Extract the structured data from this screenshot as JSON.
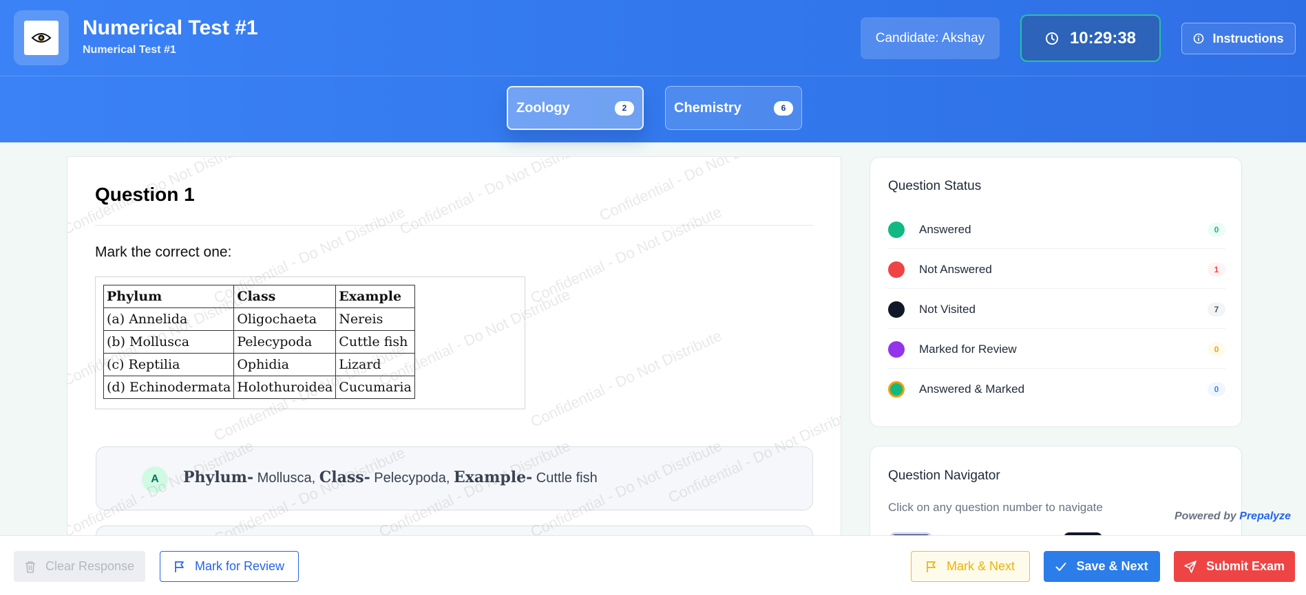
{
  "header": {
    "title": "Numerical Test #1",
    "subtitle": "Numerical Test #1",
    "candidate": "Candidate: Akshay",
    "timer": "10:29:38",
    "instructions": "Instructions"
  },
  "tabs": [
    {
      "label": "Zoology",
      "count": "2"
    },
    {
      "label": "Chemistry",
      "count": "6"
    }
  ],
  "question": {
    "title": "Question 1",
    "text": "Mark the correct one:",
    "table": {
      "headers": [
        "Phylum",
        "Class",
        "Example"
      ],
      "rows": [
        [
          "(a) Annelida",
          "Oligochaeta",
          "Nereis"
        ],
        [
          "(b) Mollusca",
          "Pelecypoda",
          "Cuttle fish"
        ],
        [
          "(c) Reptilia",
          "Ophidia",
          "Lizard"
        ],
        [
          "(d) Echinodermata",
          "Holothuroidea",
          "Cucumaria"
        ]
      ]
    },
    "options": [
      {
        "letter": "A",
        "phylum_label": "Phylum-",
        "phylum_value": "Mollusca,",
        "class_label": "Class-",
        "class_value": "Pelecypoda,",
        "example_label": "Example-",
        "example_value": "Cuttle fish"
      }
    ]
  },
  "watermark": "Confidential - Do Not Distribute",
  "status": {
    "title": "Question Status",
    "items": [
      {
        "label": "Answered",
        "count": "0",
        "color": "#10b981"
      },
      {
        "label": "Not Answered",
        "count": "1",
        "color": "#ef4444"
      },
      {
        "label": "Not Visited",
        "count": "7",
        "color": "#111827"
      },
      {
        "label": "Marked for Review",
        "count": "0",
        "color": "#9333ea"
      },
      {
        "label": "Answered & Marked",
        "count": "0",
        "color": "#10b981"
      }
    ]
  },
  "navigator": {
    "title": "Question Navigator",
    "hint": "Click on any question number to navigate"
  },
  "powered_by": {
    "prefix": "Powered by",
    "brand": "Prepalyze"
  },
  "footer": {
    "clear": "Clear Response",
    "mark_review": "Mark for Review",
    "mark_next": "Mark & Next",
    "save_next": "Save & Next",
    "submit": "Submit Exam"
  }
}
